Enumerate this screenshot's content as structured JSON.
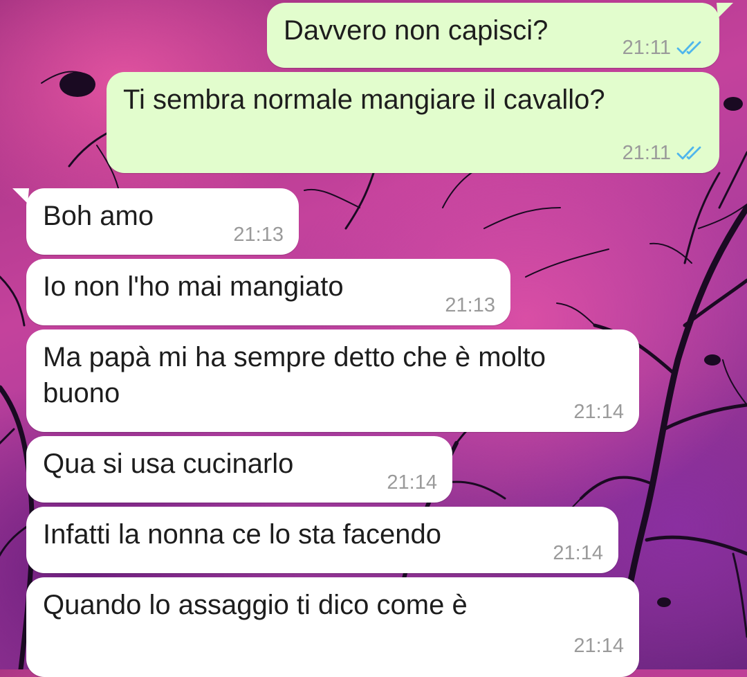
{
  "chat": {
    "colors": {
      "outgoing_bubble": "#e2fdcd",
      "incoming_bubble": "#ffffff",
      "read_receipt": "#4fb6ec",
      "timestamp": "#9a9a9a"
    },
    "messages": [
      {
        "direction": "outgoing",
        "text": "Davvero non capisci?",
        "time": "21:11",
        "status": "read",
        "status_icon": "double-check-icon"
      },
      {
        "direction": "outgoing",
        "text": "Ti sembra normale mangiare il cavallo?",
        "time": "21:11",
        "status": "read",
        "status_icon": "double-check-icon"
      },
      {
        "direction": "incoming",
        "text": "Boh amo",
        "time": "21:13"
      },
      {
        "direction": "incoming",
        "text": "Io non l'ho mai mangiato",
        "time": "21:13"
      },
      {
        "direction": "incoming",
        "text": "Ma papà mi ha sempre detto che è molto\nbuono",
        "time": "21:14"
      },
      {
        "direction": "incoming",
        "text": "Qua si usa cucinarlo",
        "time": "21:14"
      },
      {
        "direction": "incoming",
        "text": "Infatti la nonna ce lo sta facendo",
        "time": "21:14"
      },
      {
        "direction": "incoming",
        "text": "Quando lo assaggio ti dico come è",
        "time": "21:14"
      }
    ]
  }
}
